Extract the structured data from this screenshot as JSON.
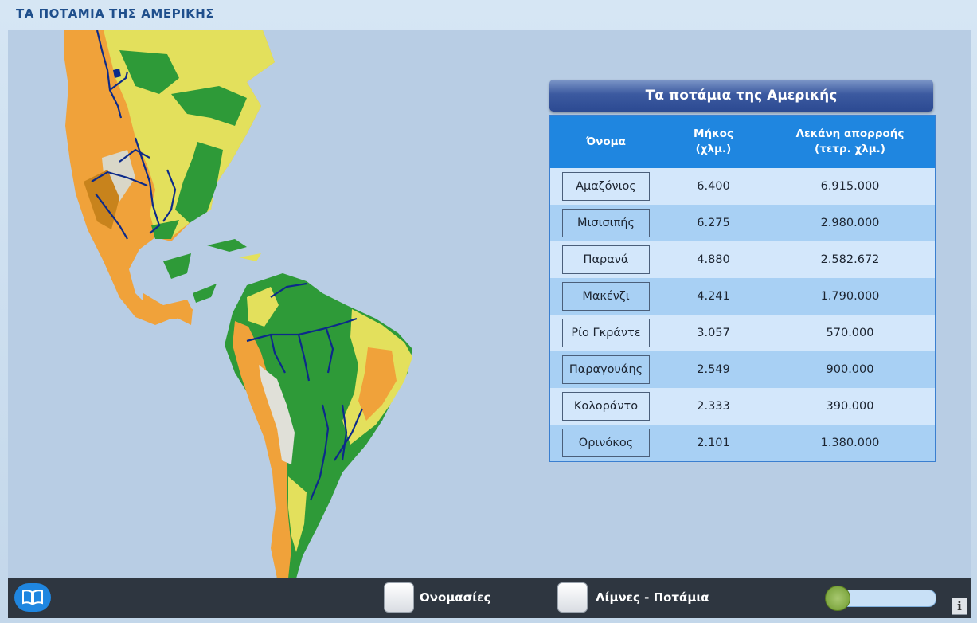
{
  "app": {
    "title": "ΤΑ ΠΟΤΑΜΙΑ ΤΗΣ ΑΜΕΡΙΚΗΣ"
  },
  "panel": {
    "title": "Τα ποτάμια της Αμερικής",
    "headers": {
      "name": "Όνομα",
      "length_line1": "Μήκος",
      "length_line2": "(χλμ.)",
      "basin_line1": "Λεκάνη απορροής",
      "basin_line2": "(τετρ. χλμ.)"
    },
    "rows": [
      {
        "name": "Αμαζόνιος",
        "length": "6.400",
        "basin": "6.915.000"
      },
      {
        "name": "Μισισιπής",
        "length": "6.275",
        "basin": "2.980.000"
      },
      {
        "name": "Παρανά",
        "length": "4.880",
        "basin": "2.582.672"
      },
      {
        "name": "Μακένζι",
        "length": "4.241",
        "basin": "1.790.000"
      },
      {
        "name": "Ρίο Γκράντε",
        "length": "3.057",
        "basin": "570.000"
      },
      {
        "name": "Παραγουάης",
        "length": "2.549",
        "basin": "900.000"
      },
      {
        "name": "Κολοράντο",
        "length": "2.333",
        "basin": "390.000"
      },
      {
        "name": "Ορινόκος",
        "length": "2.101",
        "basin": "1.380.000"
      }
    ]
  },
  "toolbar": {
    "labels_checkbox": "Ονομασίες",
    "lakes_rivers_checkbox": "Λίμνες - Ποτάμια",
    "book_icon": "book-icon",
    "info_icon": "info-icon",
    "info_glyph": "i",
    "zoom_slider_fraction": 0.0
  },
  "colors": {
    "header_blue": "#1f86e0",
    "row_light": "#d3e7fb",
    "row_dark": "#a8d0f4",
    "title_bar": "#3c5aa0",
    "bottom_bar": "#2e3640",
    "river": "#0c2a8a"
  }
}
